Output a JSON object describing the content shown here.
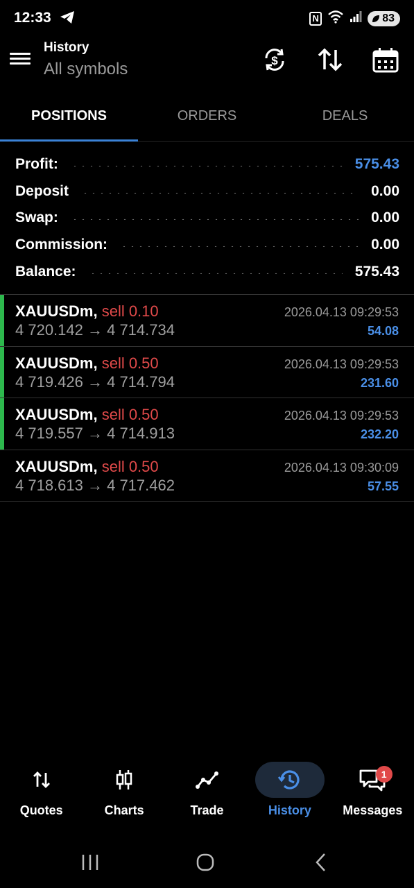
{
  "status_bar": {
    "time": "12:33",
    "battery": "83"
  },
  "header": {
    "title": "History",
    "subtitle": "All symbols"
  },
  "tabs": [
    {
      "label": "POSITIONS",
      "active": true
    },
    {
      "label": "ORDERS",
      "active": false
    },
    {
      "label": "DEALS",
      "active": false
    }
  ],
  "summary": [
    {
      "label": "Profit:",
      "value": "575.43",
      "highlight": true
    },
    {
      "label": "Deposit",
      "value": "0.00",
      "highlight": false
    },
    {
      "label": "Swap:",
      "value": "0.00",
      "highlight": false
    },
    {
      "label": "Commission:",
      "value": "0.00",
      "highlight": false
    },
    {
      "label": "Balance:",
      "value": "575.43",
      "highlight": false
    }
  ],
  "positions": [
    {
      "symbol": "XAUUSDm,",
      "side": "sell 0.10",
      "prices": "4 720.142 → 4 714.734",
      "time": "2026.04.13 09:29:53",
      "profit": "54.08",
      "bar_color": "#2db84d"
    },
    {
      "symbol": "XAUUSDm,",
      "side": "sell 0.50",
      "prices": "4 719.426 → 4 714.794",
      "time": "2026.04.13 09:29:53",
      "profit": "231.60",
      "bar_color": "#2db84d"
    },
    {
      "symbol": "XAUUSDm,",
      "side": "sell 0.50",
      "prices": "4 719.557 → 4 714.913",
      "time": "2026.04.13 09:29:53",
      "profit": "232.20",
      "bar_color": "#2db84d"
    },
    {
      "symbol": "XAUUSDm,",
      "side": "sell 0.50",
      "prices": "4 718.613 → 4 717.462",
      "time": "2026.04.13 09:30:09",
      "profit": "57.55",
      "bar_color": ""
    }
  ],
  "bottom_nav": {
    "quotes": "Quotes",
    "charts": "Charts",
    "trade": "Trade",
    "history": "History",
    "messages": "Messages",
    "messages_badge": "1"
  },
  "colors": {
    "accent": "#4a8fe7",
    "sell": "#e14a4a",
    "positive_bar": "#2db84d"
  }
}
